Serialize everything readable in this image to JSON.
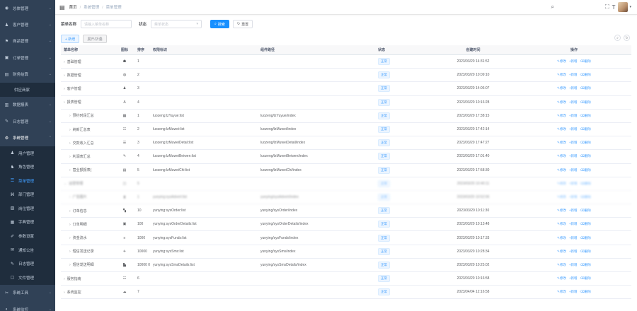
{
  "sidebar": {
    "items": [
      {
        "icon": "dashboard-icon",
        "label": "总体管理",
        "kind": "top"
      },
      {
        "icon": "user-icon",
        "label": "客户管理",
        "kind": "top"
      },
      {
        "icon": "cart-icon",
        "label": "商品管理",
        "kind": "top"
      },
      {
        "icon": "order-icon",
        "label": "订单管理",
        "kind": "top"
      },
      {
        "icon": "finance-icon",
        "label": "财务结算",
        "kind": "top"
      },
      {
        "icon": "",
        "label": "供应商家",
        "kind": "sub"
      },
      {
        "icon": "report-icon",
        "label": "数据报表",
        "kind": "top"
      },
      {
        "icon": "log-icon",
        "label": "日志管理",
        "kind": "top"
      },
      {
        "icon": "gear-icon",
        "label": "系统管理",
        "kind": "open"
      },
      {
        "icon": "user-icon",
        "label": "用户管理",
        "kind": "sub2"
      },
      {
        "icon": "role-icon",
        "label": "角色管理",
        "kind": "sub2"
      },
      {
        "icon": "menu-icon",
        "label": "菜单管理",
        "kind": "active"
      },
      {
        "icon": "dept-icon",
        "label": "部门管理",
        "kind": "sub2"
      },
      {
        "icon": "post-icon",
        "label": "岗位管理",
        "kind": "sub2"
      },
      {
        "icon": "dict-icon",
        "label": "字典管理",
        "kind": "sub2"
      },
      {
        "icon": "param-icon",
        "label": "参数设置",
        "kind": "sub2"
      },
      {
        "icon": "notice-icon",
        "label": "通知公告",
        "kind": "sub2"
      },
      {
        "icon": "log-icon",
        "label": "日志管理",
        "kind": "sub2"
      },
      {
        "icon": "file-icon",
        "label": "文件管理",
        "kind": "sub2"
      },
      {
        "icon": "tool-icon",
        "label": "系统工具",
        "kind": "top"
      },
      {
        "icon": "monitor-icon",
        "label": "系统监控",
        "kind": "top"
      }
    ]
  },
  "navbar": {
    "breadcrumb": [
      "首页",
      "系统管理",
      "菜单管理"
    ]
  },
  "search": {
    "name_label": "菜单名称",
    "name_placeholder": "请输入菜单名称",
    "status_label": "状态",
    "status_placeholder": "菜单状态",
    "search_btn": "搜索",
    "reset_btn": "重置"
  },
  "toolbar": {
    "add_btn": "+ 新增",
    "expand_btn": "展开/折叠"
  },
  "table": {
    "headers": [
      "菜单名称",
      "图标",
      "排序",
      "权限标识",
      "组件路径",
      "状态",
      "创建时间",
      "操作"
    ],
    "ops": [
      "修改",
      "新增",
      "删除"
    ],
    "rows": [
      {
        "level": 0,
        "name": "基础管理",
        "icon": "☗",
        "order": "1",
        "perm": "",
        "comp": "",
        "status": "正常",
        "time": "2023/03/20 14:31:52"
      },
      {
        "level": 0,
        "name": "数据管理",
        "icon": "◍",
        "order": "2",
        "perm": "",
        "comp": "",
        "status": "正常",
        "time": "2023/03/20 10:09:10"
      },
      {
        "level": 0,
        "name": "客户管理",
        "icon": "♟",
        "order": "3",
        "perm": "",
        "comp": "",
        "status": "正常",
        "time": "2023/03/20 14:06:07"
      },
      {
        "level": 0,
        "name": "报表管理",
        "icon": "A",
        "order": "4",
        "perm": "",
        "comp": "",
        "status": "正常",
        "time": "2023/03/20 10:16:28"
      },
      {
        "level": 1,
        "name": "预约时段汇总",
        "icon": "▦",
        "order": "1",
        "perm": "luozeng:lzYuyue:list",
        "comp": "luozeng/lzYuyue/index",
        "status": "正常",
        "time": "2023/03/20 17:38:15"
      },
      {
        "level": 1,
        "name": "纳新汇总表",
        "icon": "☷",
        "order": "2",
        "perm": "luozeng:lzMuwei:list",
        "comp": "luozeng/lzMuwei/index",
        "status": "正常",
        "time": "2023/03/20 17:42:14"
      },
      {
        "level": 1,
        "name": "交款收入汇总",
        "icon": "☰",
        "order": "3",
        "perm": "luozeng:lzMuweiDetail:list",
        "comp": "luozeng/lzMuweiDetail/index",
        "status": "正常",
        "time": "2023/03/20 17:47:27"
      },
      {
        "level": 1,
        "name": "利润表汇总",
        "icon": "✎",
        "order": "4",
        "perm": "luozeng:lzMuweiBeiwen:list",
        "comp": "luozeng/lzMuweiBeiwen/index",
        "status": "正常",
        "time": "2023/03/20 17:01:40"
      },
      {
        "level": 1,
        "name": "营业额报表(",
        "icon": "▤",
        "order": "5",
        "perm": "luozeng:lzMuweiChi:list",
        "comp": "luozeng/lzMuweiChi/index",
        "status": "正常",
        "time": "2023/03/20 17:58:30"
      },
      {
        "level": 0,
        "name": "运营管理",
        "icon": "◫",
        "order": "5",
        "perm": "",
        "comp": "",
        "status": "正常",
        "time": "2023/03/20 10:40:11",
        "open": true,
        "blur": true
      },
      {
        "level": 1,
        "name": "广告图片",
        "icon": "▮",
        "order": "1",
        "perm": "yunying:sysAdvert:list",
        "comp": "yunying/sysAdvert/index",
        "status": "正常",
        "time": "2023/03/20 10:52:06",
        "blur": true
      },
      {
        "level": 1,
        "name": "订单信息",
        "icon": "▚",
        "order": "10",
        "perm": "yunying:sysOrder:list",
        "comp": "yunying/sysOrder/index",
        "status": "正常",
        "time": "2023/03/20 10:11:30"
      },
      {
        "level": 1,
        "name": "订单明细",
        "icon": "▣",
        "order": "100",
        "perm": "yunying:sysOrderDetails:list",
        "comp": "yunying/sysOrderDetails/index",
        "status": "正常",
        "time": "2023/03/20 10:13:48"
      },
      {
        "level": 1,
        "name": "资金流水",
        "icon": "≡",
        "order": "1000",
        "perm": "yunying:sysFunds:list",
        "comp": "yunying/sysFunds/index",
        "status": "正常",
        "time": "2023/03/20 10:17:33"
      },
      {
        "level": 1,
        "name": "短信发送记录",
        "icon": "✈",
        "order": "10000",
        "perm": "yunying:sysSms:list",
        "comp": "yunying/sysSms/index",
        "status": "正常",
        "time": "2023/03/20 10:28:34"
      },
      {
        "level": 1,
        "name": "短信发送明细",
        "icon": "▙",
        "order": "10000 0",
        "perm": "yunying:sysSmsDetails:list",
        "comp": "yunying/sysSmsDetails/index",
        "status": "正常",
        "time": "2023/03/20 10:25:02"
      },
      {
        "level": 0,
        "name": "服务指南",
        "icon": "☷",
        "order": "6",
        "perm": "",
        "comp": "",
        "status": "正常",
        "time": "2023/03/20 10:16:58"
      },
      {
        "level": 0,
        "name": "系统监控",
        "icon": "☁",
        "order": "7",
        "perm": "",
        "comp": "",
        "status": "正常",
        "time": "2023/04/04 12:16:58"
      }
    ]
  },
  "colors": {
    "sidebar_bg": "#304156",
    "primary": "#1890ff",
    "status_tag": "#409eff"
  }
}
